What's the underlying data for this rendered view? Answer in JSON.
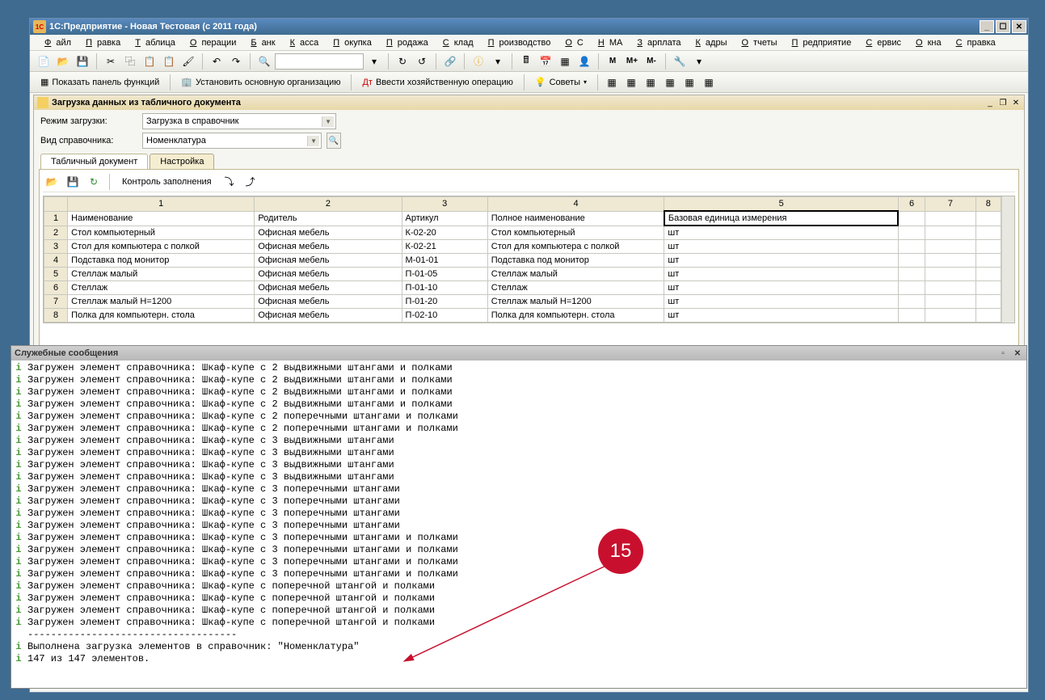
{
  "window_title": "1С:Предприятие - Новая Тестовая (с 2011 года)",
  "menu": {
    "items": [
      "Файл",
      "Правка",
      "Таблица",
      "Операции",
      "Банк",
      "Касса",
      "Покупка",
      "Продажа",
      "Склад",
      "Производство",
      "ОС",
      "НМА",
      "Зарплата",
      "Кадры",
      "Отчеты",
      "Предприятие",
      "Сервис",
      "Окна",
      "Справка"
    ]
  },
  "toolbar2": {
    "show_panel": "Показать панель функций",
    "set_main_org": "Установить основную организацию",
    "enter_op": "Ввести хозяйственную операцию",
    "tips": "Советы"
  },
  "subwindow": {
    "title": "Загрузка данных из табличного документа",
    "load_mode_label": "Режим загрузки:",
    "load_mode_value": "Загрузка в справочник",
    "ref_type_label": "Вид справочника:",
    "ref_type_value": "Номенклатура",
    "tab1": "Табличный документ",
    "tab2": "Настройка",
    "check_fill": "Контроль заполнения"
  },
  "grid": {
    "col_numbers": [
      "1",
      "2",
      "3",
      "4",
      "5",
      "6",
      "7",
      "8"
    ],
    "headers": [
      "Наименование",
      "Родитель",
      "Артикул",
      "Полное наименование",
      "Базовая единица измерения"
    ],
    "rows": [
      {
        "n": "2",
        "name": "Стол компьютерный",
        "parent": "Офисная мебель",
        "sku": "К-02-20",
        "full": "Стол компьютерный",
        "unit": "шт"
      },
      {
        "n": "3",
        "name": "Стол для компьютера с полкой",
        "parent": "Офисная мебель",
        "sku": "К-02-21",
        "full": "Стол для компьютера с полкой",
        "unit": "шт"
      },
      {
        "n": "4",
        "name": "Подставка под монитор",
        "parent": "Офисная мебель",
        "sku": "М-01-01",
        "full": "Подставка под монитор",
        "unit": "шт"
      },
      {
        "n": "5",
        "name": "Стеллаж малый",
        "parent": "Офисная мебель",
        "sku": "П-01-05",
        "full": "Стеллаж малый",
        "unit": "шт"
      },
      {
        "n": "6",
        "name": "Стеллаж",
        "parent": "Офисная мебель",
        "sku": "П-01-10",
        "full": "Стеллаж",
        "unit": "шт"
      },
      {
        "n": "7",
        "name": "Стеллаж малый Н=1200",
        "parent": "Офисная мебель",
        "sku": "П-01-20",
        "full": "Стеллаж малый Н=1200",
        "unit": "шт"
      },
      {
        "n": "8",
        "name": "Полка для компьютерн. стола",
        "parent": "Офисная мебель",
        "sku": "П-02-10",
        "full": "Полка для компьютерн. стола",
        "unit": "шт"
      }
    ]
  },
  "messages_title": "Служебные сообщения",
  "messages": [
    "Загружен элемент справочника: Шкаф-купе с 2 выдвижными штангами и полками",
    "Загружен элемент справочника: Шкаф-купе с 2 выдвижными штангами и полками",
    "Загружен элемент справочника: Шкаф-купе с 2 выдвижными штангами и полками",
    "Загружен элемент справочника: Шкаф-купе с 2 выдвижными штангами и полками",
    "Загружен элемент справочника: Шкаф-купе с 2 поперечными штангами и полками",
    "Загружен элемент справочника: Шкаф-купе с 2 поперечными штангами и полками",
    "Загружен элемент справочника: Шкаф-купе с 3 выдвижными штангами",
    "Загружен элемент справочника: Шкаф-купе с 3 выдвижными штангами",
    "Загружен элемент справочника: Шкаф-купе с 3 выдвижными штангами",
    "Загружен элемент справочника: Шкаф-купе с 3 выдвижными штангами",
    "Загружен элемент справочника: Шкаф-купе с 3 поперечными штангами",
    "Загружен элемент справочника: Шкаф-купе с 3 поперечными штангами",
    "Загружен элемент справочника: Шкаф-купе с 3 поперечными штангами",
    "Загружен элемент справочника: Шкаф-купе с 3 поперечными штангами",
    "Загружен элемент справочника: Шкаф-купе с 3 поперечными штангами и полками",
    "Загружен элемент справочника: Шкаф-купе с 3 поперечными штангами и полками",
    "Загружен элемент справочника: Шкаф-купе с 3 поперечными штангами и полками",
    "Загружен элемент справочника: Шкаф-купе с 3 поперечными штангами и полками",
    "Загружен элемент справочника: Шкаф-купе с поперечной штангой и полками",
    "Загружен элемент справочника: Шкаф-купе с поперечной штангой и полками",
    "Загружен элемент справочника: Шкаф-купе с поперечной штангой и полками",
    "Загружен элемент справочника: Шкаф-купе с поперечной штангой и полками"
  ],
  "messages_dashes": "------------------------------------",
  "messages_done": "Выполнена загрузка элементов в справочник: \"Номенклатура\"",
  "messages_count": "147 из 147 элементов.",
  "annotation_number": "15"
}
